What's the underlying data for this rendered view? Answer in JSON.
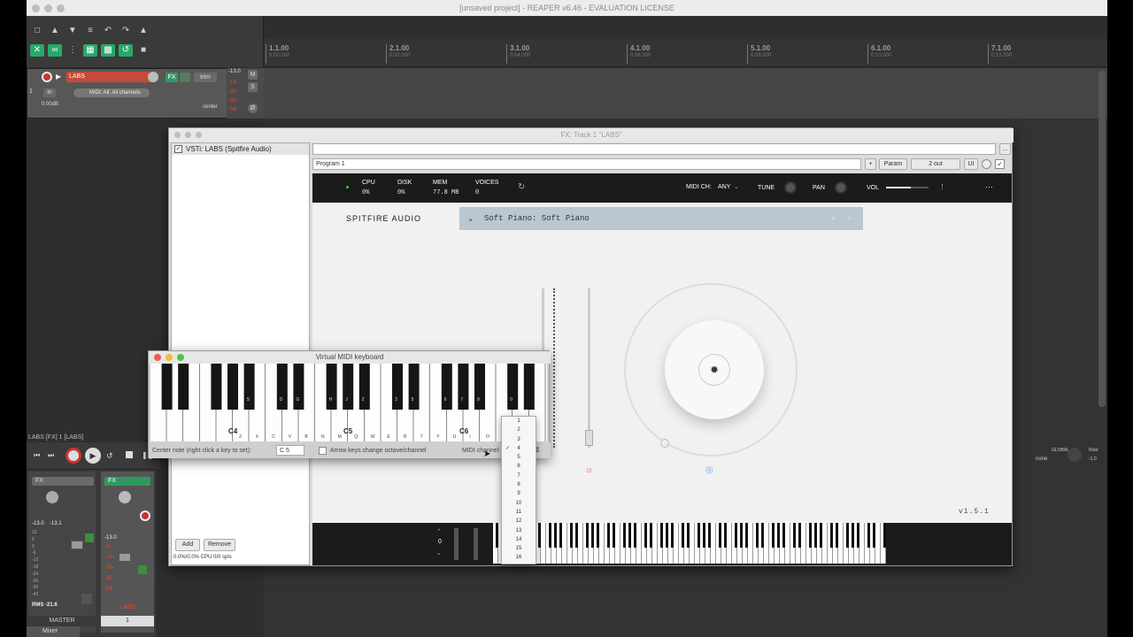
{
  "window": {
    "title": "[unsaved project] - REAPER v6.46 - EVALUATION LICENSE"
  },
  "ruler": [
    {
      "bar": "1.1.00",
      "time": "0:00.000"
    },
    {
      "bar": "2.1.00",
      "time": "0:02.000"
    },
    {
      "bar": "3.1.00",
      "time": "0:04.000"
    },
    {
      "bar": "4.1.00",
      "time": "0:06.000"
    },
    {
      "bar": "5.1.00",
      "time": "0:08.000"
    },
    {
      "bar": "6.1.00",
      "time": "0:10.000"
    },
    {
      "bar": "7.1.00",
      "time": "0:12.000"
    }
  ],
  "track": {
    "number": "1",
    "name": "LABS",
    "fx": "FX",
    "trim": "trim",
    "input": "in",
    "midi_input": "MIDI: All: All channels",
    "volume": "0.00dB",
    "pan": "center",
    "meter_peak": "-13.0",
    "meter_ticks": [
      "-18-",
      "-30-",
      "-42-",
      "-54-"
    ],
    "m": "M",
    "s": "S"
  },
  "transport": {
    "label": "LABS [FX] 1 [LABS]"
  },
  "mixer": {
    "tab": "Mixer",
    "master_label": "MASTER",
    "master_peaks": [
      "-13.0",
      "-13.1"
    ],
    "master_rms": "RMS -21.6",
    "scale": [
      "12",
      "6",
      "0",
      "-6",
      "-12",
      "-18",
      "-24",
      "-30",
      "-36",
      "-42"
    ],
    "track_label": "LABS",
    "track_number": "1",
    "track_peak": "-13.0",
    "track_red_ticks": [
      "-6-",
      "-18-",
      "-30-",
      "-42-",
      "-54-"
    ],
    "route": "Route",
    "fx": "FX",
    "center": "center",
    "global": "GLOBAL",
    "none": "none",
    "role": "Role:",
    "role_val": "-1.0"
  },
  "fxwindow": {
    "title": "FX: Track 1 \"LABS\"",
    "plugin_item": "VSTi: LABS (Spitfire Audio)",
    "program": "Program 1",
    "plus": "+",
    "param": "Param",
    "out": "2 out",
    "ui": "UI",
    "add": "Add",
    "remove": "Remove",
    "cpu_status": "0.0%/0.0% CPU 0/0 spls",
    "more": "..."
  },
  "plugin": {
    "cpu_label": "CPU",
    "cpu_val": "0%",
    "disk_label": "DISK",
    "disk_val": "0%",
    "mem_label": "MEM",
    "mem_val": "77.8 MB",
    "voices_label": "VOICES",
    "voices_val": "0",
    "midich_label": "MIDI CH:",
    "midich_val": "ANY",
    "tune": "TUNE",
    "pan": "PAN",
    "vol": "VOL",
    "brand": "SPITFIRE AUDIO",
    "preset": "Soft Piano: Soft Piano",
    "version": "v1.5.1",
    "octave": "0",
    "menu": "···"
  },
  "vmk": {
    "title": "Virtual MIDI keyboard",
    "octave_labels": [
      "C4",
      "C5",
      "C6"
    ],
    "black_letters": [
      "S",
      "D",
      "G",
      "H",
      "J",
      "2",
      "3",
      "5",
      "6",
      "7",
      "9",
      "0"
    ],
    "white_letters": [
      "Z",
      "X",
      "C",
      "V",
      "B",
      "N",
      "M",
      "Q",
      "W",
      "E",
      "R",
      "T",
      "Y",
      "U",
      "I",
      "O",
      "P"
    ],
    "center_note_label": "Center note (right click a key to set):",
    "center_note_value": "C 5",
    "arrow_keys_label": "Arrow keys change octave/channel",
    "midi_channel_label": "MIDI channel:"
  },
  "dropdown": {
    "items": [
      "1",
      "2",
      "3",
      "4",
      "5",
      "6",
      "7",
      "8",
      "9",
      "10",
      "11",
      "12",
      "13",
      "14",
      "15",
      "16"
    ],
    "selected": "4"
  }
}
